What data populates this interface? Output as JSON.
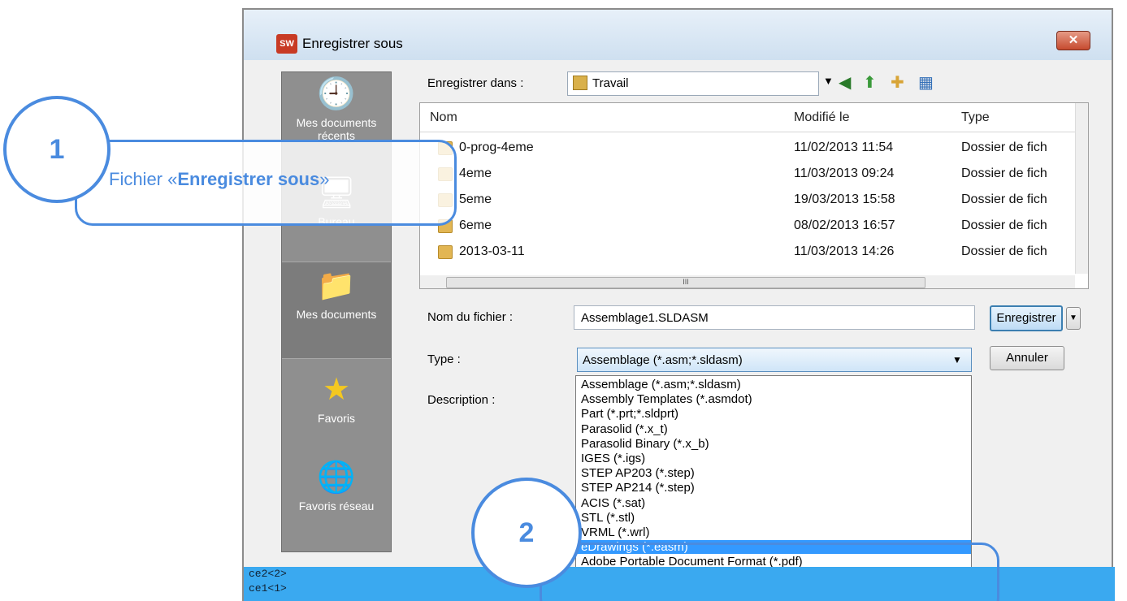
{
  "window": {
    "title": "Enregistrer sous",
    "app_icon": "SW",
    "close_glyph": "✕"
  },
  "places": [
    {
      "label": "Mes documents récents",
      "icon": "recent-clock-icon"
    },
    {
      "label": "Bureau",
      "icon": "desktop-icon"
    },
    {
      "label": "Mes documents",
      "icon": "my-documents-icon"
    },
    {
      "label": "Favoris",
      "icon": "star-icon"
    },
    {
      "label": "Favoris réseau",
      "icon": "network-globe-icon"
    }
  ],
  "save_in": {
    "label": "Enregistrer dans :",
    "value": "Travail"
  },
  "list": {
    "columns": [
      "Nom",
      "Modifié le",
      "Type"
    ],
    "rows": [
      {
        "name": "0-prog-4eme",
        "modified": "11/02/2013 11:54",
        "type": "Dossier de fich"
      },
      {
        "name": "4eme",
        "modified": "11/03/2013 09:24",
        "type": "Dossier de fich"
      },
      {
        "name": "5eme",
        "modified": "19/03/2013 15:58",
        "type": "Dossier de fich"
      },
      {
        "name": "6eme",
        "modified": "08/02/2013 16:57",
        "type": "Dossier de fich"
      },
      {
        "name": "2013-03-11",
        "modified": "11/03/2013 14:26",
        "type": "Dossier de fich"
      }
    ],
    "hscroll_thumb": "III"
  },
  "filename": {
    "label": "Nom du fichier :",
    "value": "Assemblage1.SLDASM"
  },
  "type": {
    "label": "Type :",
    "value": "Assemblage (*.asm;*.sldasm)"
  },
  "description": {
    "label": "Description :"
  },
  "buttons": {
    "save": "Enregistrer",
    "cancel": "Annuler"
  },
  "type_options": [
    "Assemblage (*.asm;*.sldasm)",
    "Assembly Templates (*.asmdot)",
    "Part (*.prt;*.sldprt)",
    "Parasolid (*.x_t)",
    "Parasolid Binary (*.x_b)",
    "IGES (*.igs)",
    "STEP AP203 (*.step)",
    "STEP AP214 (*.step)",
    "ACIS (*.sat)",
    "STL (*.stl)",
    "VRML (*.wrl)",
    "eDrawings (*.easm)",
    "Adobe Portable Document Format (*.pdf)"
  ],
  "selected_option_index": 11,
  "bottom_strip": [
    "ce2<2>",
    "ce1<1>"
  ],
  "callouts": {
    "one": {
      "number": "1",
      "prefix": "Fichier «",
      "bold": "Enregistrer sous",
      "suffix": "»"
    },
    "two": {
      "number": "2"
    }
  },
  "colors": {
    "callout": "#4a8bdf",
    "selection": "#3399ff",
    "strip": "#3aa9f0"
  }
}
